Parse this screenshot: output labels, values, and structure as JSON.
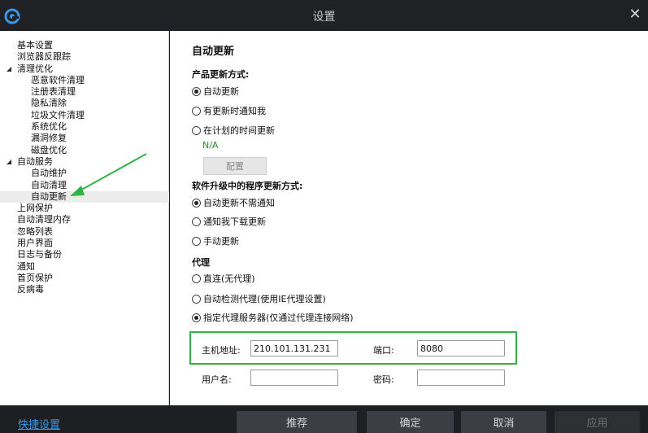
{
  "window": {
    "title": "设置",
    "close_label": "✕"
  },
  "sidebar": {
    "items": [
      {
        "label": "基本设置",
        "level": 0,
        "expander": ""
      },
      {
        "label": "浏览器反跟踪",
        "level": 0,
        "expander": ""
      },
      {
        "label": "清理优化",
        "level": 0,
        "expander": "◢"
      },
      {
        "label": "恶意软件清理",
        "level": 1
      },
      {
        "label": "注册表清理",
        "level": 1
      },
      {
        "label": "隐私清除",
        "level": 1
      },
      {
        "label": "垃圾文件清理",
        "level": 1
      },
      {
        "label": "系统优化",
        "level": 1
      },
      {
        "label": "漏洞修复",
        "level": 1
      },
      {
        "label": "磁盘优化",
        "level": 1
      },
      {
        "label": "自动服务",
        "level": 0,
        "expander": "◢"
      },
      {
        "label": "自动维护",
        "level": 1
      },
      {
        "label": "自动清理",
        "level": 1
      },
      {
        "label": "自动更新",
        "level": 1,
        "selected": true
      },
      {
        "label": "上网保护",
        "level": 0,
        "expander": ""
      },
      {
        "label": "自动清理内存",
        "level": 0,
        "expander": ""
      },
      {
        "label": "忽略列表",
        "level": 0,
        "expander": ""
      },
      {
        "label": "用户界面",
        "level": 0,
        "expander": ""
      },
      {
        "label": "日志与备份",
        "level": 0,
        "expander": ""
      },
      {
        "label": "通知",
        "level": 0,
        "expander": ""
      },
      {
        "label": "首页保护",
        "level": 0,
        "expander": ""
      },
      {
        "label": "反病毒",
        "level": 0,
        "expander": ""
      }
    ]
  },
  "main": {
    "title": "自动更新",
    "product_update": {
      "heading": "产品更新方式:",
      "options": [
        {
          "label": "自动更新",
          "checked": true
        },
        {
          "label": "有更新时通知我",
          "checked": false
        },
        {
          "label": "在计划的时间更新",
          "checked": false
        }
      ],
      "schedule_status": "N/A",
      "config_label": "配置"
    },
    "program_update": {
      "heading": "软件升级中的程序更新方式:",
      "options": [
        {
          "label": "自动更新不需通知",
          "checked": true
        },
        {
          "label": "通知我下载更新",
          "checked": false
        },
        {
          "label": "手动更新",
          "checked": false
        }
      ]
    },
    "proxy": {
      "heading": "代理",
      "options": [
        {
          "label": "直连(无代理)",
          "checked": false
        },
        {
          "label": "自动检测代理(使用IE代理设置)",
          "checked": false
        },
        {
          "label": "指定代理服务器(仅通过代理连接网络)",
          "checked": true
        }
      ],
      "host_label": "主机地址:",
      "host_value": "210.101.131.231",
      "port_label": "端口:",
      "port_value": "8080",
      "user_label": "用户名:",
      "user_value": "",
      "password_label": "密码:",
      "password_value": ""
    }
  },
  "footer": {
    "quick_settings": "快捷设置",
    "recommend": "推荐",
    "ok": "确定",
    "cancel": "取消",
    "apply": "应用"
  },
  "colors": {
    "highlight": "#34b249",
    "link": "#3a97e8",
    "status_green": "#2e8b2e"
  }
}
